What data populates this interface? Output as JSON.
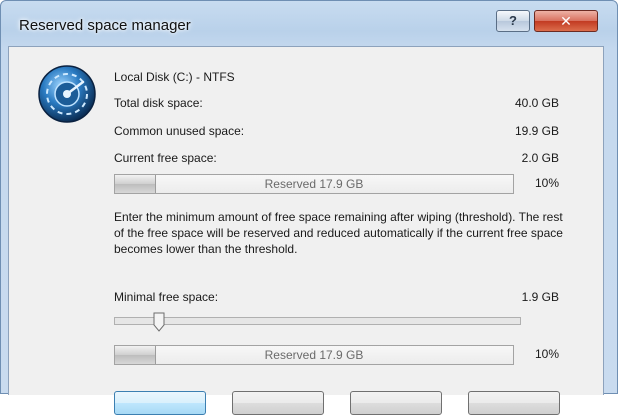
{
  "window": {
    "title": "Reserved space manager",
    "help_label": "?",
    "close_label": "✕"
  },
  "disk": {
    "name": "Local Disk (C:) - NTFS",
    "total_label": "Total disk space:",
    "total_value": "40.0 GB",
    "unused_label": "Common unused space:",
    "unused_value": "19.9 GB",
    "free_label": "Current free space:",
    "free_value": "2.0 GB"
  },
  "reserved_bar": {
    "text": "Reserved 17.9 GB",
    "percent_label": "10%",
    "fill_fraction": 0.1
  },
  "description": "Enter the minimum amount of free space remaining after wiping (threshold). The rest of the free space will be reserved and reduced automatically if the current free space becomes lower than the threshold.",
  "threshold": {
    "label": "Minimal free space:",
    "value": "1.9 GB",
    "slider_fraction": 0.11
  },
  "threshold_bar": {
    "text": "Reserved 17.9 GB",
    "percent_label": "10%",
    "fill_fraction": 0.1
  },
  "icons": {
    "app": "disk-wipe-icon"
  }
}
